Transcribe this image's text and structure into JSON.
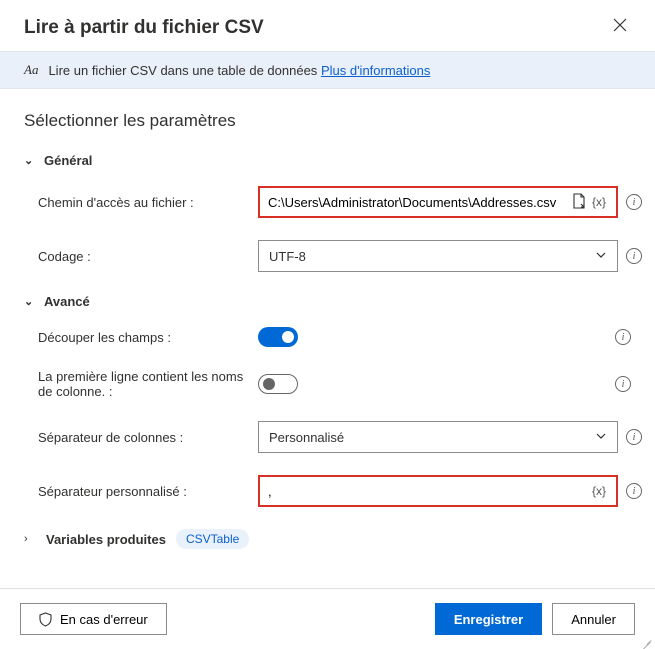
{
  "header": {
    "title": "Lire à partir du fichier CSV"
  },
  "info": {
    "prefix": "Aa",
    "text": "Lire un fichier CSV dans une table de données",
    "link": "Plus d'informations"
  },
  "subtitle": "Sélectionner les paramètres",
  "sections": {
    "general": "Général",
    "advanced": "Avancé"
  },
  "fields": {
    "filepath": {
      "label": "Chemin d'accès au fichier :",
      "value": "C:\\Users\\Administrator\\Documents\\Addresses.csv"
    },
    "encoding": {
      "label": "Codage :",
      "value": "UTF-8"
    },
    "trim": {
      "label": "Découper les champs :",
      "value": true
    },
    "firstline": {
      "label": "La première ligne contient les noms de colonne. :",
      "value": false
    },
    "colsep": {
      "label": "Séparateur de colonnes :",
      "value": "Personnalisé"
    },
    "customsep": {
      "label": "Séparateur personnalisé :",
      "value": ","
    }
  },
  "variables": {
    "label": "Variables produites",
    "chip": "CSVTable"
  },
  "footer": {
    "onerror": "En cas d'erreur",
    "save": "Enregistrer",
    "cancel": "Annuler"
  }
}
